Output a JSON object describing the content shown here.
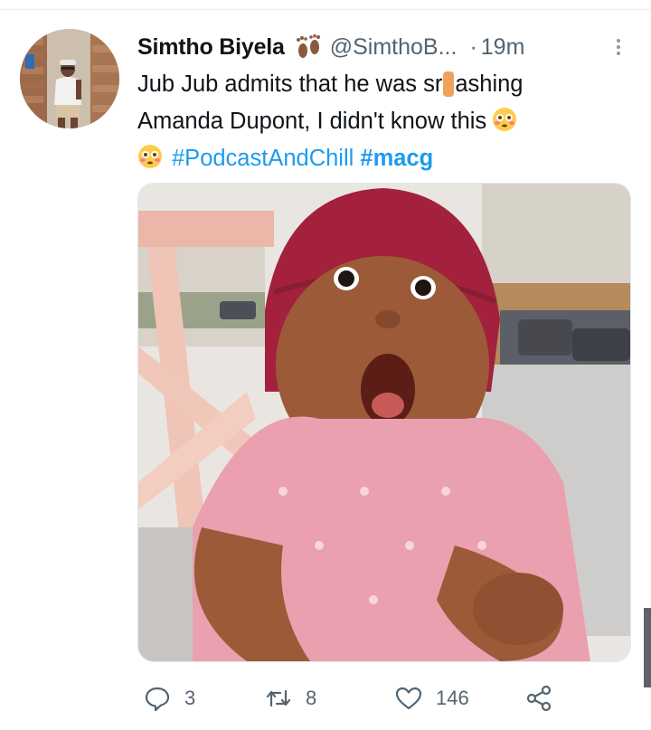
{
  "tweet": {
    "display_name": "Simtho Biyela",
    "name_emoji": "footprints-icon",
    "handle": "@SimthoB...",
    "separator": "·",
    "time": "19m",
    "text_line1": "Jub Jub admits that he was sr",
    "text_line1_after_censor": "ashing",
    "text_line2": "Amanda Dupont, I didn't know this",
    "hashtag_1": "#PodcastAndChill",
    "hashtag_2": "#macg",
    "emoji_face": "flushed-face-icon",
    "media_description_icon": "baby-photo"
  },
  "actions": {
    "reply_count": "3",
    "retweet_count": "8",
    "like_count": "146"
  },
  "colors": {
    "hashtag": "#1d9bf0",
    "secondary_text": "#536471",
    "primary_text": "#0f1419",
    "censor_mark": "#f0a15e"
  }
}
